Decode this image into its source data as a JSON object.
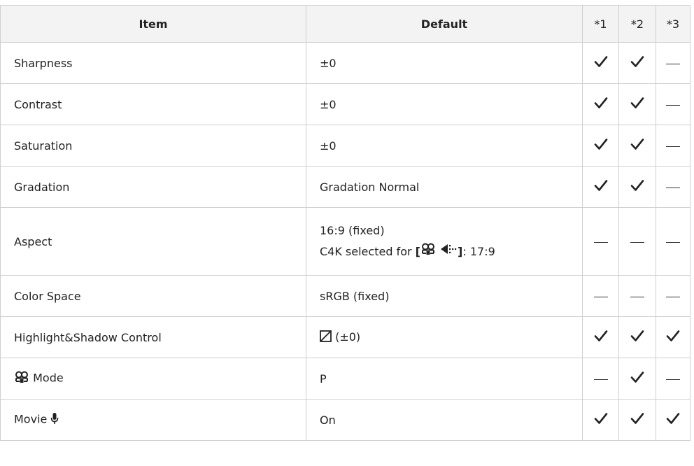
{
  "table": {
    "headers": {
      "item": "Item",
      "default": "Default",
      "f1": "*1",
      "f2": "*2",
      "f3": "*3"
    },
    "rows": [
      {
        "item": "Sharpness",
        "default": "±0",
        "f1": "check",
        "f2": "check",
        "f3": "dash"
      },
      {
        "item": "Contrast",
        "default": "±0",
        "f1": "check",
        "f2": "check",
        "f3": "dash"
      },
      {
        "item": "Saturation",
        "default": "±0",
        "f1": "check",
        "f2": "check",
        "f3": "dash"
      },
      {
        "item": "Gradation",
        "default": "Gradation Normal",
        "f1": "check",
        "f2": "check",
        "f3": "dash"
      },
      {
        "item": "Aspect",
        "default_line1": "16:9 (fixed)",
        "default_line2_prefix": "C4K selected for ",
        "default_line2_open": "[",
        "default_line2_close": "]",
        "default_line2_suffix": ": 17:9",
        "default_icons": [
          "movie-camera-icon",
          "movie-quality-icon"
        ],
        "f1": "dash",
        "f2": "dash",
        "f3": "dash"
      },
      {
        "item": "Color Space",
        "default": "sRGB (fixed)",
        "f1": "dash",
        "f2": "dash",
        "f3": "dash"
      },
      {
        "item": "Highlight&Shadow Control",
        "default": "(±0)",
        "default_icon": "tone-curve-icon",
        "f1": "check",
        "f2": "check",
        "f3": "check"
      },
      {
        "item": "Mode",
        "item_icon": "movie-camera-icon",
        "default": "P",
        "f1": "dash",
        "f2": "check",
        "f3": "dash"
      },
      {
        "item": "Movie",
        "item_icon": "microphone-icon",
        "default": "On",
        "f1": "check",
        "f2": "check",
        "f3": "check"
      }
    ]
  },
  "colors": {
    "header_bg": "#f3f3f3",
    "border": "#cfcfcf",
    "text": "#222222"
  }
}
